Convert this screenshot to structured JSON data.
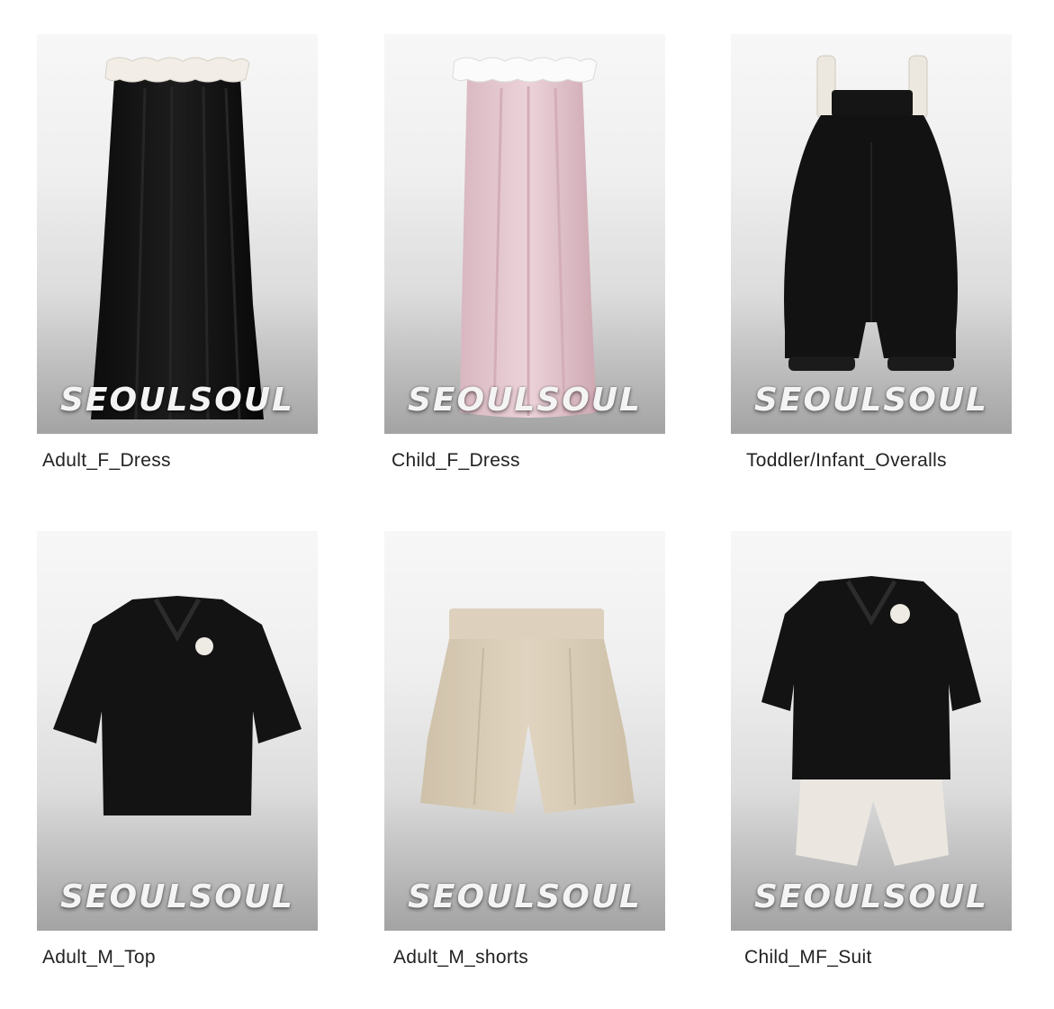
{
  "products": [
    {
      "name": "Adult_F_Dress",
      "watermark": "SEOULSOUL",
      "image_icon": "dress-black-icon"
    },
    {
      "name": "Child_F_Dress",
      "watermark": "SEOULSOUL",
      "image_icon": "dress-pink-icon"
    },
    {
      "name": "Toddler/Infant_Overalls",
      "watermark": "SEOULSOUL",
      "image_icon": "overalls-icon"
    },
    {
      "name": "Adult_M_Top",
      "watermark": "SEOULSOUL",
      "image_icon": "tshirt-icon"
    },
    {
      "name": "Adult_M_shorts",
      "watermark": "SEOULSOUL",
      "image_icon": "shorts-icon"
    },
    {
      "name": "Child_MF_Suit",
      "watermark": "SEOULSOUL",
      "image_icon": "suit-icon"
    }
  ],
  "colors": {
    "garment_black": "#111111",
    "garment_pink": "#e6c8d0",
    "garment_beige": "#ddd0bb",
    "garment_cream": "#ebe7e0",
    "ruffle_white": "#f3efe9"
  }
}
